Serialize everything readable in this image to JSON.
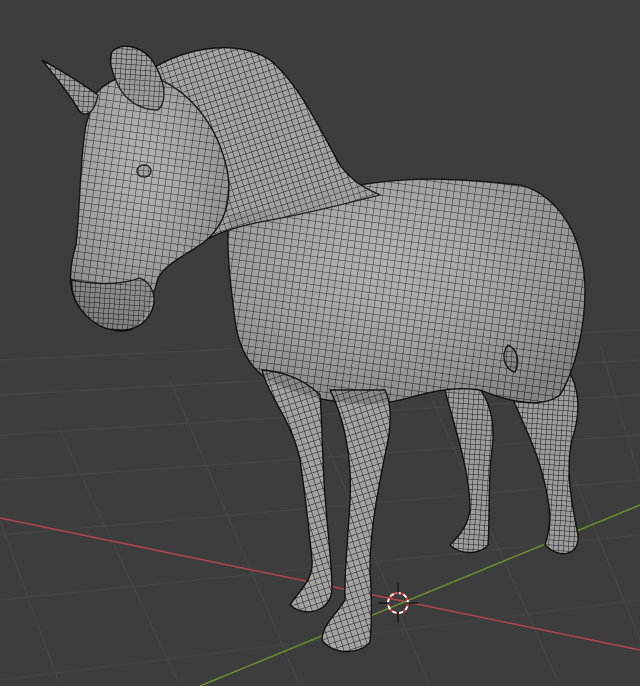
{
  "app": {
    "view": "3d-viewport",
    "shading": "solid-wireframe"
  },
  "viewport": {
    "background_color": "#3d3d3d",
    "grid_color": "#4a4a4a",
    "x_axis_color": "#b5434f",
    "y_axis_color": "#6b8e2d",
    "mesh_fill_color": "#a6a6a6",
    "mesh_wire_color": "#1e1e1e"
  },
  "scene": {
    "object": "horse",
    "cursor": "3d-cursor"
  }
}
